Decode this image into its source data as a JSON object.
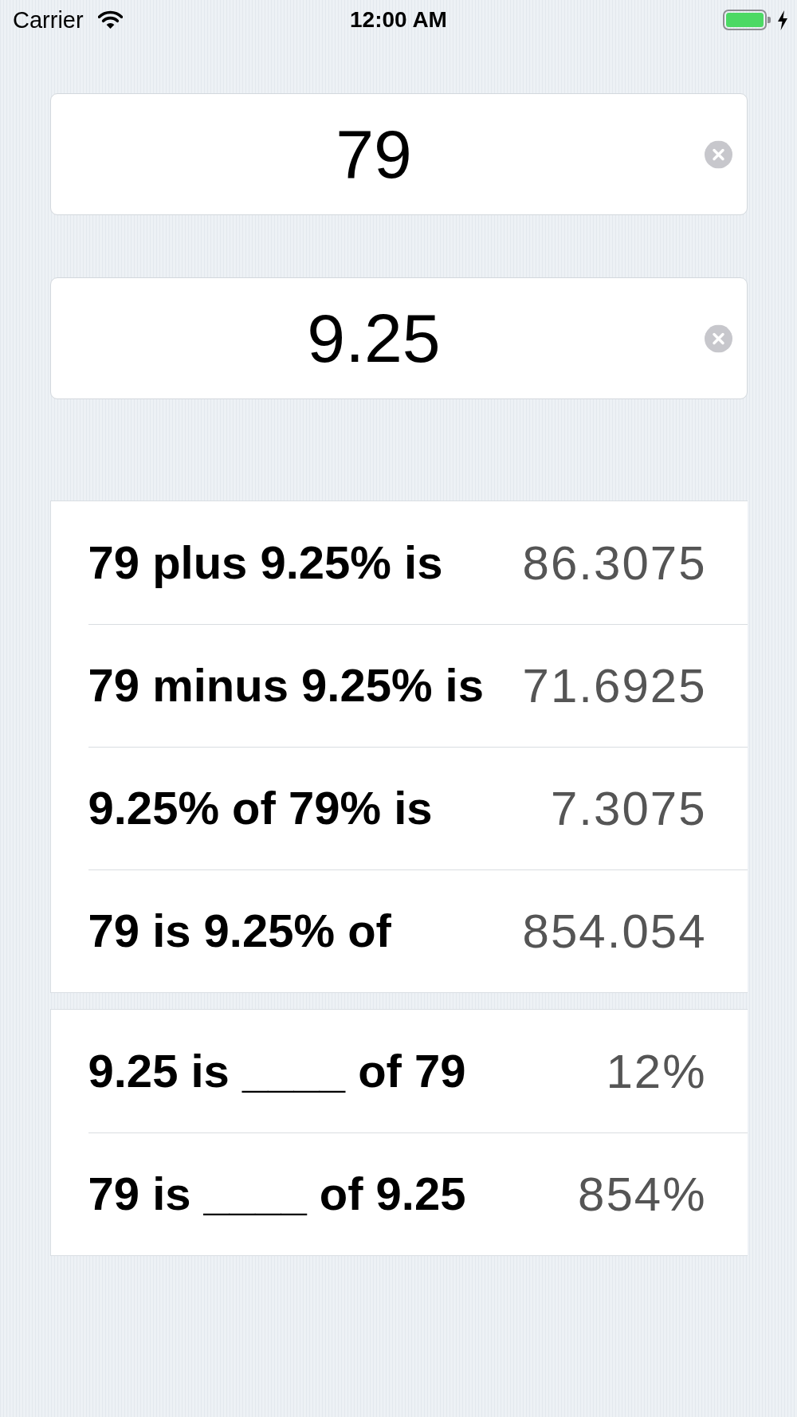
{
  "status_bar": {
    "carrier": "Carrier",
    "time": "12:00 AM"
  },
  "fields": [
    {
      "value": "79"
    },
    {
      "value": "9.25"
    }
  ],
  "sections": [
    {
      "rows": [
        {
          "label": "79 plus 9.25% is",
          "result": "86.3075"
        },
        {
          "label": "79 minus 9.25% is",
          "result": "71.6925"
        },
        {
          "label": "9.25% of 79% is",
          "result": "7.3075"
        },
        {
          "label": "79 is 9.25% of",
          "result": "854.054"
        }
      ]
    },
    {
      "rows": [
        {
          "label": "9.25 is ____ of 79",
          "result": "12%"
        },
        {
          "label": "79 is ____ of 9.25",
          "result": "854%"
        }
      ]
    }
  ]
}
